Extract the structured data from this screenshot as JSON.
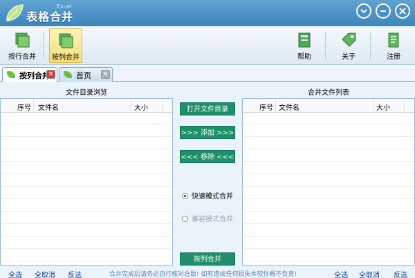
{
  "app": {
    "title": "表格合并",
    "subtitle": "Excel"
  },
  "window_buttons": [
    {
      "name": "collapse-icon"
    },
    {
      "name": "minimize-icon"
    },
    {
      "name": "close-icon"
    }
  ],
  "toolbar": {
    "merge_by_row": "按行合并",
    "merge_by_column": "按列合并",
    "help": "帮助",
    "about": "关于",
    "register": "注册"
  },
  "tabs": [
    {
      "label": "按列合并",
      "active": true
    },
    {
      "label": "首页",
      "active": false
    }
  ],
  "left_panel": {
    "title": "文件目录浏览",
    "columns": [
      "序号",
      "文件名",
      "大小"
    ]
  },
  "right_panel": {
    "title": "合并文件列表",
    "columns": [
      "序号",
      "文件名",
      "大小"
    ]
  },
  "actions": {
    "open_dir": "打开文件目录",
    "add": ">>> 添加 >>>",
    "remove": "<<< 移除 <<<",
    "merge": "按列合并"
  },
  "modes": {
    "fast": "快速模式合并",
    "compat": "兼容模式合并",
    "selected": "fast"
  },
  "status": {
    "left_select_all": "全选",
    "left_deselect": "全取消",
    "left_invert": "反选",
    "message": "合并完成后请务必自行核对总数! 如有造成任何损失本软件概不负责!",
    "right_select_all": "全选",
    "right_deselect": "全取消",
    "right_invert": "反选"
  },
  "colors": {
    "accent": "#1e8f6a",
    "titlebar": "#4a90c5",
    "link": "#1a3f8a"
  }
}
